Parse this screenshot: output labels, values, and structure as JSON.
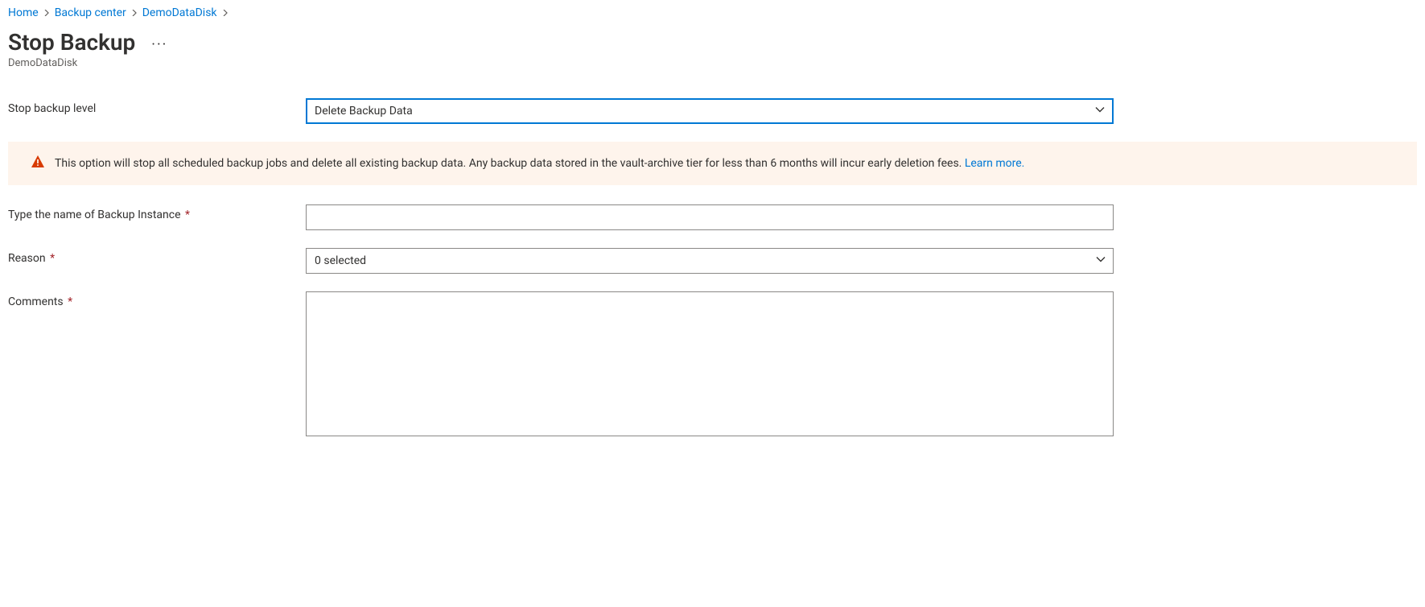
{
  "breadcrumb": {
    "items": [
      {
        "label": "Home"
      },
      {
        "label": "Backup center"
      },
      {
        "label": "DemoDataDisk"
      }
    ]
  },
  "header": {
    "title": "Stop Backup",
    "subtitle": "DemoDataDisk"
  },
  "form": {
    "stopLevel": {
      "label": "Stop backup level",
      "value": "Delete Backup Data"
    },
    "warning": {
      "text": "This option will stop all scheduled backup jobs and delete all existing backup data. Any backup data stored in the vault-archive tier for less than 6 months will incur early deletion fees. ",
      "link": "Learn more."
    },
    "instanceName": {
      "label": "Type the name of Backup Instance",
      "value": ""
    },
    "reason": {
      "label": "Reason",
      "value": "0 selected"
    },
    "comments": {
      "label": "Comments",
      "value": ""
    }
  }
}
